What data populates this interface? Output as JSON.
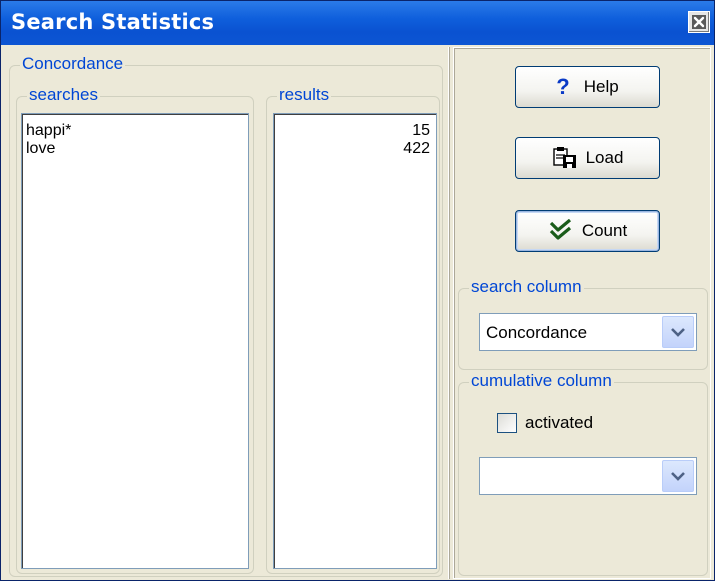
{
  "window": {
    "title": "Search Statistics"
  },
  "concordance_group": {
    "label": "Concordance",
    "searches": {
      "label": "searches",
      "items": [
        "happi*",
        "love"
      ]
    },
    "results": {
      "label": "results",
      "items": [
        "15",
        "422"
      ]
    }
  },
  "buttons": {
    "help": "Help",
    "load": "Load",
    "count": "Count"
  },
  "search_column": {
    "label": "search column",
    "selected": "Concordance"
  },
  "cumulative_column": {
    "label": "cumulative column",
    "checkbox_label": "activated",
    "checked": false,
    "selected": ""
  },
  "colors": {
    "title_bar": "#0a52d1",
    "group_label": "#0046d5",
    "window_bg": "#ece9d8"
  }
}
